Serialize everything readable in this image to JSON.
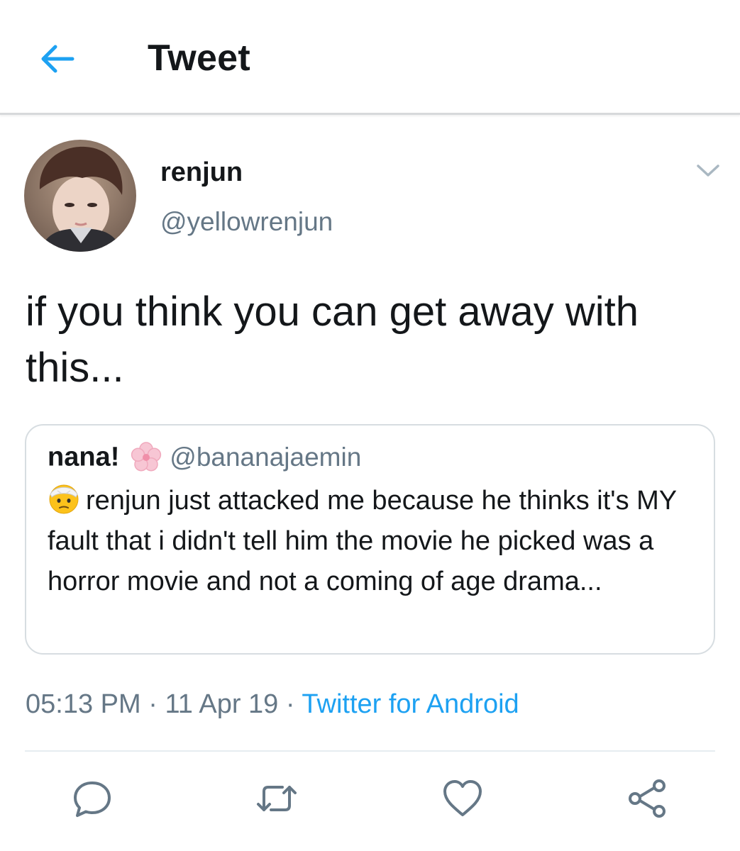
{
  "header": {
    "back_icon": "arrow-left-icon",
    "title": "Tweet"
  },
  "tweet": {
    "author_name": "renjun",
    "author_handle": "@yellowrenjun",
    "text": "if you think you can get away with this...",
    "caret_icon": "chevron-down-icon"
  },
  "quote": {
    "name": "nana!",
    "name_emoji": "cherry-blossom-emoji",
    "handle": "@bananajaemin",
    "text_emoji": "face-with-head-bandage-emoji",
    "text": "renjun just attacked me because he thinks it's MY fault that i didn't tell him the movie he picked was a horror movie and not a coming of age drama..."
  },
  "meta": {
    "time": "05:13 PM",
    "separator": "·",
    "date": "11 Apr 19",
    "source": "Twitter for Android"
  },
  "actions": [
    {
      "name": "reply",
      "icon": "reply-icon"
    },
    {
      "name": "retweet",
      "icon": "retweet-icon"
    },
    {
      "name": "like",
      "icon": "heart-icon"
    },
    {
      "name": "share",
      "icon": "share-icon"
    }
  ],
  "colors": {
    "accent": "#1da1f2",
    "secondary_text": "#657786",
    "primary_text": "#14171a",
    "border": "#d7dde1",
    "icon_gray": "#657786"
  }
}
